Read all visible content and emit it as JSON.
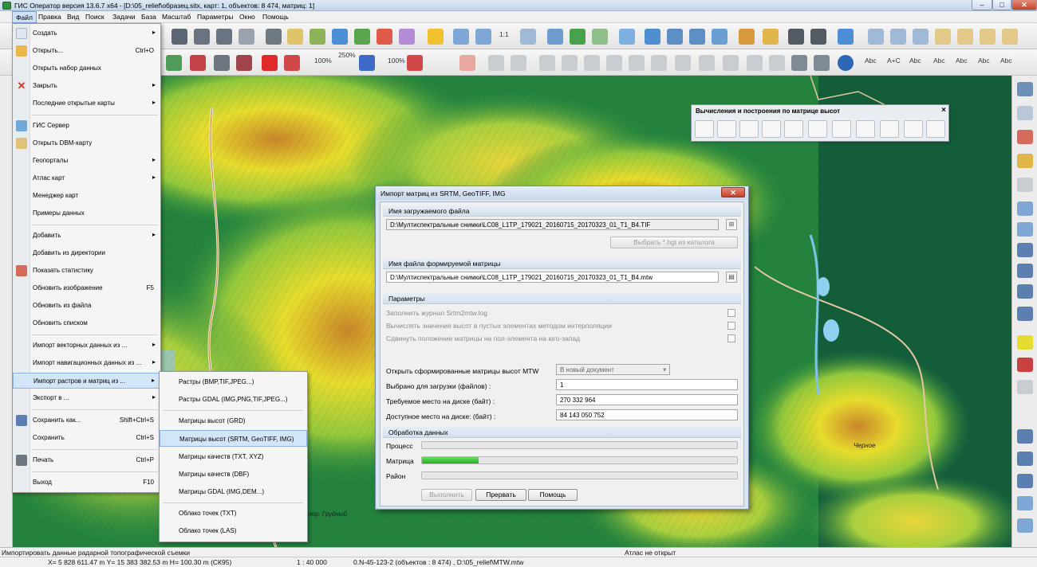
{
  "window": {
    "title": "ГИС Оператор версия 13.6.7 x64 - [D:\\05_relief\\образец.sitx, карт: 1, объектов: 8 474, матриц: 1]"
  },
  "menubar": [
    "Файл",
    "Правка",
    "Вид",
    "Поиск",
    "Задачи",
    "База",
    "Масштаб",
    "Параметры",
    "Окно",
    "Помощь"
  ],
  "toolbar": {
    "zoom_ratio": "1:1",
    "pct_100": "100%",
    "pct_250": "250%",
    "abc_1": "Abc",
    "abc_2": "A+C",
    "abc_3": "Abc"
  },
  "file_menu": {
    "items": [
      {
        "label": "Создать",
        "shortcut": "",
        "arrow": "▸",
        "icon": "new-icon"
      },
      {
        "label": "Открыть...",
        "shortcut": "Ctrl+O",
        "arrow": "",
        "icon": "open-folder-icon"
      },
      {
        "label": "Открыть набор данных",
        "shortcut": "",
        "arrow": "",
        "icon": ""
      },
      {
        "label": "Закрыть",
        "shortcut": "",
        "arrow": "▸",
        "icon": "close-red-x-icon"
      },
      {
        "label": "Последние открытые карты",
        "shortcut": "",
        "arrow": "▸",
        "icon": ""
      },
      {
        "label": "ГИС Сервер",
        "shortcut": "",
        "arrow": "",
        "icon": "server-icon"
      },
      {
        "label": "Открыть DBM-карту",
        "shortcut": "",
        "arrow": "",
        "icon": "dbm-icon"
      },
      {
        "label": "Геопорталы",
        "shortcut": "",
        "arrow": "▸",
        "icon": ""
      },
      {
        "label": "Атлас карт",
        "shortcut": "",
        "arrow": "▸",
        "icon": ""
      },
      {
        "label": "Менеджер карт",
        "shortcut": "",
        "arrow": "",
        "icon": ""
      },
      {
        "label": "Примеры данных",
        "shortcut": "",
        "arrow": "",
        "icon": ""
      },
      {
        "label": "Добавить",
        "shortcut": "",
        "arrow": "▸",
        "icon": ""
      },
      {
        "label": "Добавить из директории",
        "shortcut": "",
        "arrow": "",
        "icon": ""
      },
      {
        "label": "Показать статистику",
        "shortcut": "",
        "arrow": "",
        "icon": "statistics-icon"
      },
      {
        "label": "Обновить изображение",
        "shortcut": "F5",
        "arrow": "",
        "icon": ""
      },
      {
        "label": "Обновить из файла",
        "shortcut": "",
        "arrow": "",
        "icon": ""
      },
      {
        "label": "Обновить списком",
        "shortcut": "",
        "arrow": "",
        "icon": ""
      },
      {
        "label": "Импорт векторных данных из ...",
        "shortcut": "",
        "arrow": "▸",
        "icon": ""
      },
      {
        "label": "Импорт навигационных данных из ...",
        "shortcut": "",
        "arrow": "▸",
        "icon": ""
      },
      {
        "label": "Импорт растров и матриц из ...",
        "shortcut": "",
        "arrow": "▸",
        "icon": ""
      },
      {
        "label": "Экспорт в ...",
        "shortcut": "",
        "arrow": "▸",
        "icon": ""
      },
      {
        "label": "Сохранить как...",
        "shortcut": "Shift+Ctrl+S",
        "arrow": "",
        "icon": "save-as-icon"
      },
      {
        "label": "Сохранить",
        "shortcut": "Ctrl+S",
        "arrow": "",
        "icon": ""
      },
      {
        "label": "Печать",
        "shortcut": "Ctrl+P",
        "arrow": "",
        "icon": "printer-icon"
      },
      {
        "label": "Выход",
        "shortcut": "F10",
        "arrow": "",
        "icon": ""
      }
    ]
  },
  "import_submenu": {
    "items": [
      "Растры (BMP,TIF,JPEG...)",
      "Растры GDAL (IMG,PNG,TIF,JPEG...)",
      "Матрицы высот (GRD)",
      "Матрицы высот (SRTM, GeoTIFF, IMG)",
      "Матрицы качеств (TXT, XYZ)",
      "Матрицы качеств (DBF)",
      "Матрицы GDAL (IMG,DEM...)",
      "Облако точек (TXT)",
      "Облако точек (LAS)"
    ]
  },
  "calc_panel": {
    "title": "Вычисления и построения по матрице высот"
  },
  "dialog": {
    "title": "Импорт матриц из SRTM, GeoTIFF, IMG",
    "source_section": "Имя загружаемого файла",
    "source_path": "D:\\Мултиспектральные снимки\\LC08_L1TP_179021_20160715_20170323_01_T1_B4.TIF",
    "choose_hgt_button": "Выбрать *.hgt из каталога",
    "target_section": "Имя файла формируемой матрицы",
    "target_path": "D:\\Мултиспектральные снимки\\LC08_L1TP_179021_20160715_20170323_01_T1_B4.mtw",
    "params_section": "Параметры",
    "opt_log": "Заполнить журнал Srtm2mtw.log",
    "opt_interp": "Вычислять значения высот в пустых элементах методом интерполяции",
    "opt_shift": "Сдвинуть положение матрицы на пол-элемента на юго-запад",
    "open_label": "Открыть сформированные матрицы высот MTW",
    "open_value": "В новый документ",
    "selected_label": "Выбрано для загрузки (файлов) :",
    "selected_value": "1",
    "required_label": "Требуемое место на диске (байт) :",
    "required_value": "270 332 964",
    "available_label": "Доступное место на диске: (байт) :",
    "available_value": "84 143 050 752",
    "processing_section": "Обработка данных",
    "progress": [
      {
        "label": "Процесс",
        "fraction": 0
      },
      {
        "label": "Матрица",
        "fraction": 0.18
      },
      {
        "label": "Район",
        "fraction": 0
      }
    ],
    "btn_run": "Выполнить",
    "btn_abort": "Прервать",
    "btn_help": "Помощь"
  },
  "map": {
    "label_1": "пер. Грудный",
    "label_2": "Черное"
  },
  "status": {
    "hint": "Импортировать данные радарной топографической съемки",
    "atlas": "Атлас не открыт",
    "coords": "X= 5 828 611.47 m  Y= 15 383 382.53 m  H= 100.30 m  (СК95)",
    "scale": "1 : 40 000",
    "sheet": "0.N-45-123-2  (объектов : 8 474) , D:\\05_relief\\MTW.mtw"
  },
  "colors": {
    "accent": "#3399ff",
    "close_red": "#c6422a",
    "progress_green": "#22b51d",
    "map_green": "#1f7d3a",
    "map_yellow": "#e6dc2d",
    "map_orange": "#c9862a"
  }
}
